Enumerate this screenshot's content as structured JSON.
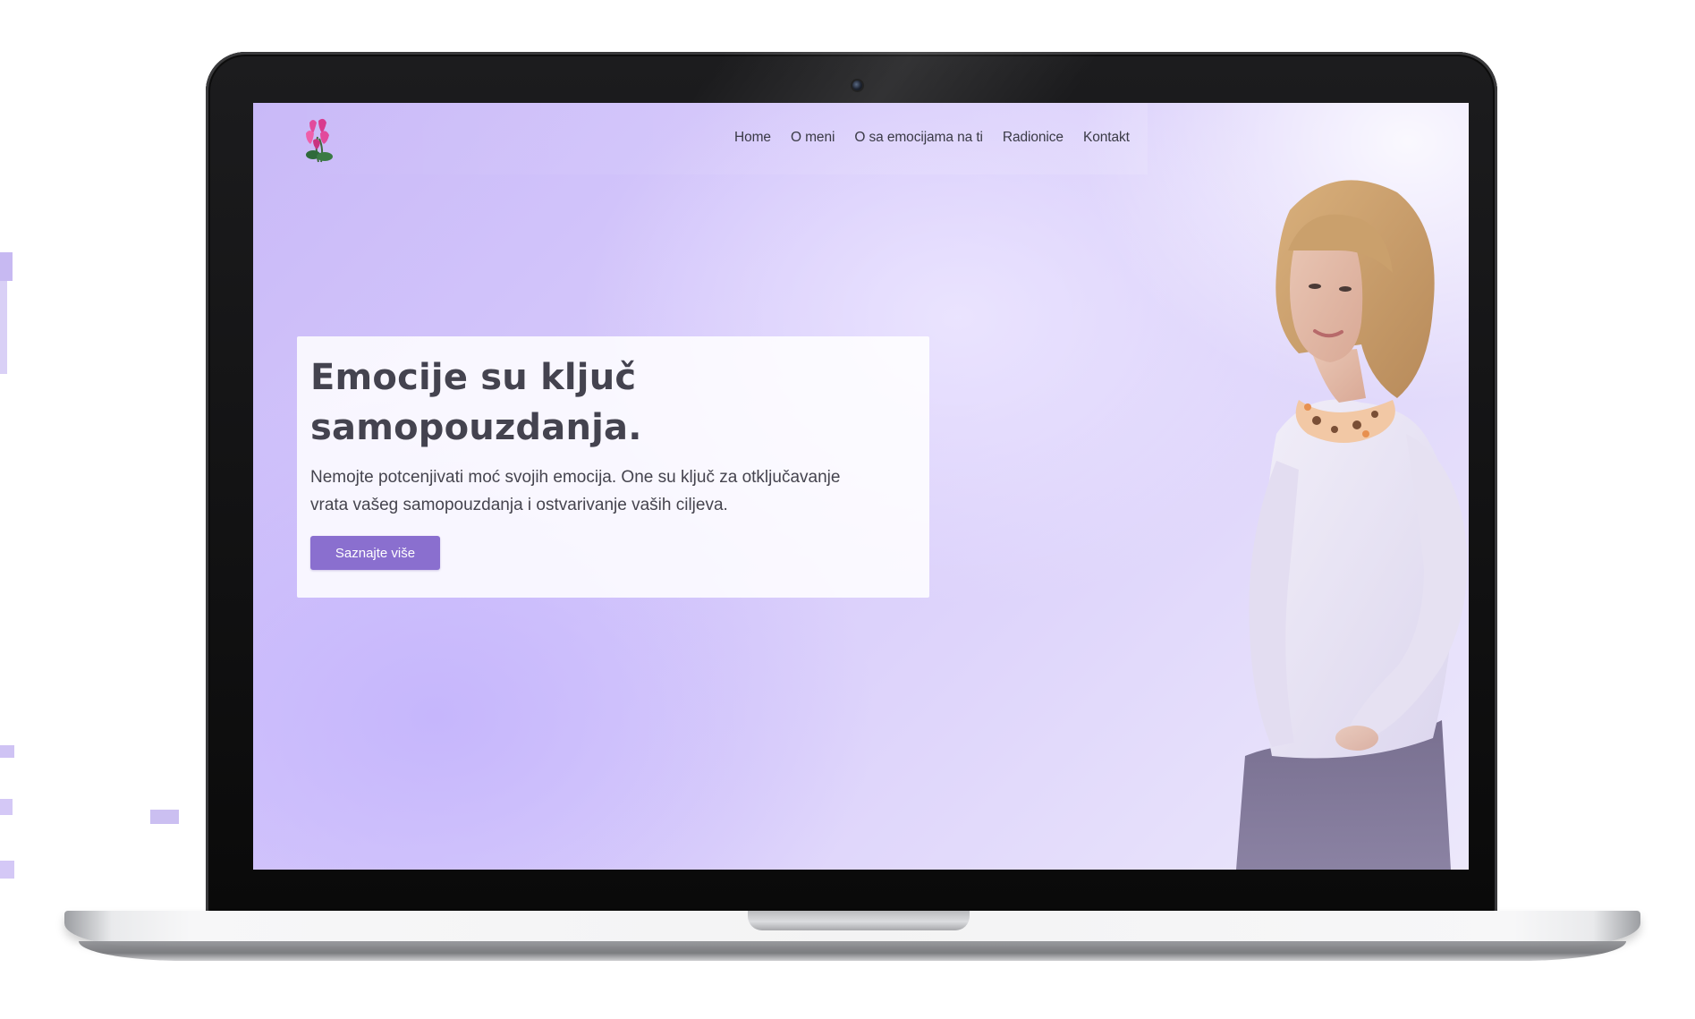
{
  "site": {
    "logo_icon": "cyclamen-flower-logo"
  },
  "nav": {
    "items": [
      {
        "label": "Home"
      },
      {
        "label": "O meni"
      },
      {
        "label": "O sa emocijama na ti"
      },
      {
        "label": "Radionice"
      },
      {
        "label": "Kontakt"
      }
    ]
  },
  "hero": {
    "title": "Emocije su ključ samopouzdanja.",
    "text": "Nemojte potcenjivati moć svojih emocija. One su ključ za otključavanje vrata vašeg samopouzdanja i ostvarivanje vaših ciljeva.",
    "cta_label": "Saznajte više",
    "image_icon": "woman-portrait-image"
  },
  "colors": {
    "accent": "#8a6fcf",
    "background_start": "#c9b9f8",
    "background_end": "#ece8fb",
    "text": "#44434f"
  }
}
